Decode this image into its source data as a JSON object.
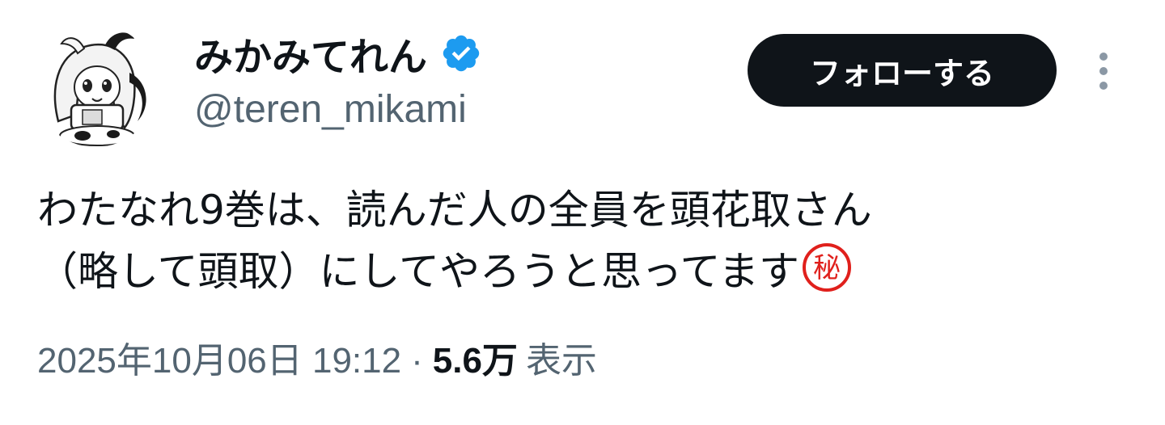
{
  "user": {
    "display_name": "みかみてれん",
    "handle": "@teren_mikami",
    "verified": true,
    "avatar_icon": "avatar-illustration-icon",
    "verified_icon": "verified-badge-icon"
  },
  "actions": {
    "follow_label": "フォローする",
    "more_icon": "more-vertical-icon"
  },
  "tweet": {
    "line1": "わたなれ9巻は、読んだ人の全員を頭花取さん",
    "line2": "（略して頭取）にしてやろうと思ってます",
    "emoji_glyph": "秘",
    "emoji_name": "circled-secret-emoji"
  },
  "meta": {
    "datetime": "2025年10月06日 19:12",
    "separator": "·",
    "views": "5.6万",
    "views_label": "表示"
  },
  "colors": {
    "text_primary": "#0f1419",
    "text_secondary": "#536471",
    "verified_blue": "#1d9bf0",
    "button_bg": "#0f1419",
    "secret_red": "#e0201c"
  }
}
